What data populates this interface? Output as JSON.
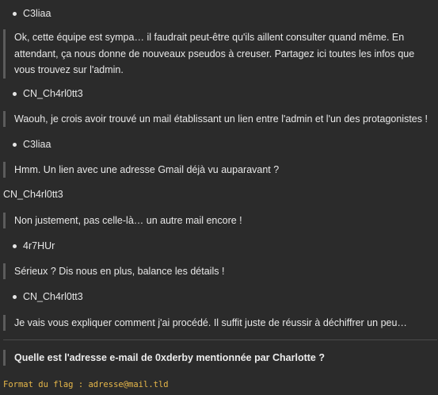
{
  "conversation": [
    {
      "speaker": "C3liaa",
      "bulleted": true,
      "message": "Ok, cette équipe est sympa… il faudrait peut-être qu'ils aillent consulter quand même. En attendant, ça nous donne de nouveaux pseudos à creuser. Partagez ici toutes les infos que vous trouvez sur l'admin."
    },
    {
      "speaker": "CN_Ch4rl0tt3",
      "bulleted": true,
      "message": "Waouh, je crois avoir trouvé un mail établissant un lien entre l'admin et l'un des protagonistes !"
    },
    {
      "speaker": "C3liaa",
      "bulleted": true,
      "message": "Hmm. Un lien avec une adresse Gmail déjà vu auparavant ?"
    },
    {
      "speaker": "CN_Ch4rl0tt3",
      "bulleted": false,
      "message": "Non justement, pas celle-là… un autre mail encore !"
    },
    {
      "speaker": "4r7HUr",
      "bulleted": true,
      "message": "Sérieux ? Dis nous en plus, balance les détails !"
    },
    {
      "speaker": "CN_Ch4rl0tt3",
      "bulleted": true,
      "message": "Je vais vous expliquer comment j'ai procédé. Il suffit juste de réussir à déchiffrer un peu…"
    }
  ],
  "question": "Quelle est l'adresse e-mail de 0xderby mentionnée par Charlotte ?",
  "flag_format": "Format du flag : adresse@mail.tld",
  "colors": {
    "background": "#2b2b2b",
    "text": "#e6e6e6",
    "quote_border": "#5c5c5c",
    "flag_format": "#e8b84a"
  }
}
